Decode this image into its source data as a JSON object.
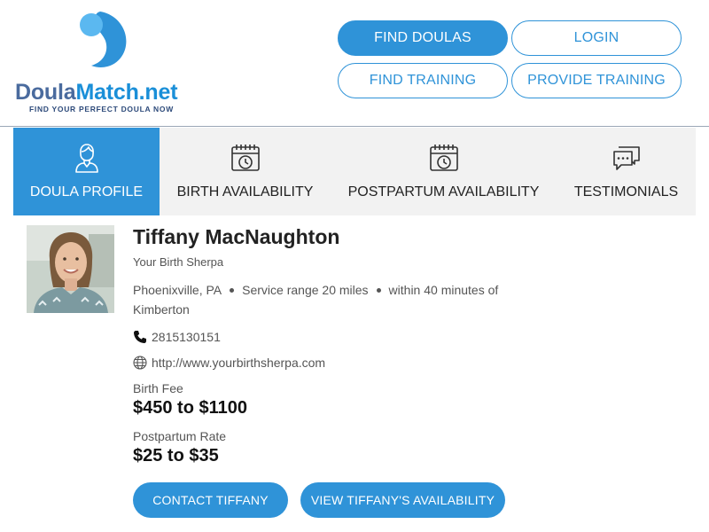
{
  "brand": {
    "name_part1": "Doula",
    "name_part2": "Match.net",
    "tagline": "FIND YOUR PERFECT DOULA NOW",
    "logo_icon": "doula-swirl-logo",
    "colors": {
      "primary": "#2f93d8",
      "dark": "#4a6b9e",
      "light": "#5bb8f0"
    }
  },
  "header_nav": {
    "find_doulas": "FIND DOULAS",
    "login": "LOGIN",
    "find_training": "FIND TRAINING",
    "provide_training": "PROVIDE TRAINING"
  },
  "tabs": [
    {
      "label": "DOULA PROFILE",
      "icon": "person-icon",
      "active": true
    },
    {
      "label": "BIRTH AVAILABILITY",
      "icon": "calendar-clock-icon",
      "active": false
    },
    {
      "label": "POSTPARTUM AVAILABILITY",
      "icon": "calendar-clock-icon",
      "active": false
    },
    {
      "label": "TESTIMONIALS",
      "icon": "chat-bubbles-icon",
      "active": false
    }
  ],
  "profile": {
    "name": "Tiffany MacNaughton",
    "business": "Your Birth Sherpa",
    "location": "Phoenixville, PA",
    "service_range": "Service range 20 miles",
    "proximity": "within 40 minutes of Kimberton",
    "phone": "2815130151",
    "website": "http://www.yourbirthsherpa.com",
    "birth_fee_label": "Birth Fee",
    "birth_fee": "$450 to $1100",
    "postpartum_label": "Postpartum Rate",
    "postpartum_rate": "$25 to $35"
  },
  "actions": {
    "contact": "CONTACT TIFFANY",
    "availability": "VIEW TIFFANY'S AVAILABILITY"
  }
}
